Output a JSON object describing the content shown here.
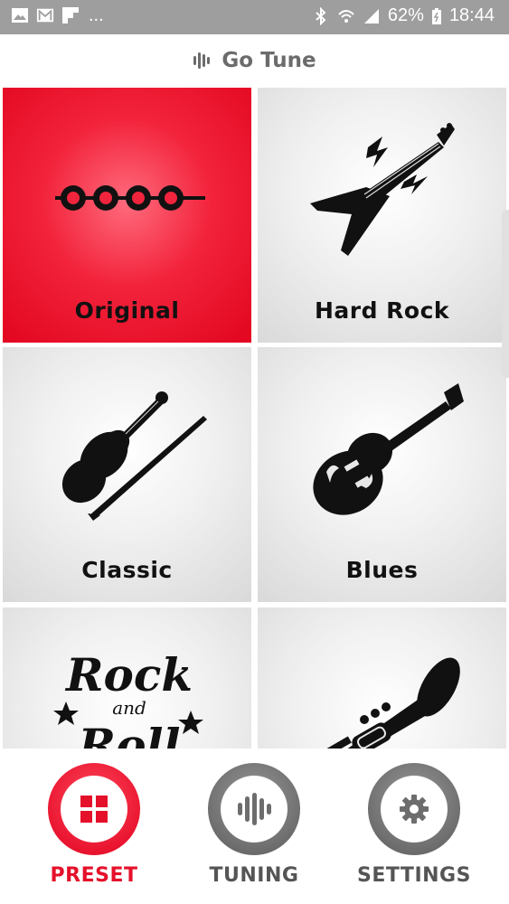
{
  "status_bar": {
    "left_icons": [
      "image-icon",
      "gmail-icon",
      "flipboard-icon"
    ],
    "more": "...",
    "battery_percent": "62%",
    "time": "18:44"
  },
  "app": {
    "title": "Go Tune"
  },
  "presets": [
    {
      "label": "Original",
      "icon": "tuning-pegs-icon",
      "selected": true
    },
    {
      "label": "Hard Rock",
      "icon": "flying-v-guitar-icon",
      "selected": false
    },
    {
      "label": "Classic",
      "icon": "violin-icon",
      "selected": false
    },
    {
      "label": "Blues",
      "icon": "hollow-body-guitar-icon",
      "selected": false
    },
    {
      "label": "",
      "icon": "rock-and-roll-icon",
      "selected": false,
      "art_text": [
        "Rock",
        "and",
        "Roll"
      ]
    },
    {
      "label": "",
      "icon": "trumpet-icon",
      "selected": false
    }
  ],
  "bottom_nav": [
    {
      "label": "PRESET",
      "icon": "grid-icon",
      "active": true
    },
    {
      "label": "TUNING",
      "icon": "waveform-icon",
      "active": false
    },
    {
      "label": "SETTINGS",
      "icon": "gear-icon",
      "active": false
    }
  ],
  "colors": {
    "accent": "#e5102a",
    "status_bar": "#9e9e9e",
    "nav_inactive": "#6d6d6d"
  }
}
